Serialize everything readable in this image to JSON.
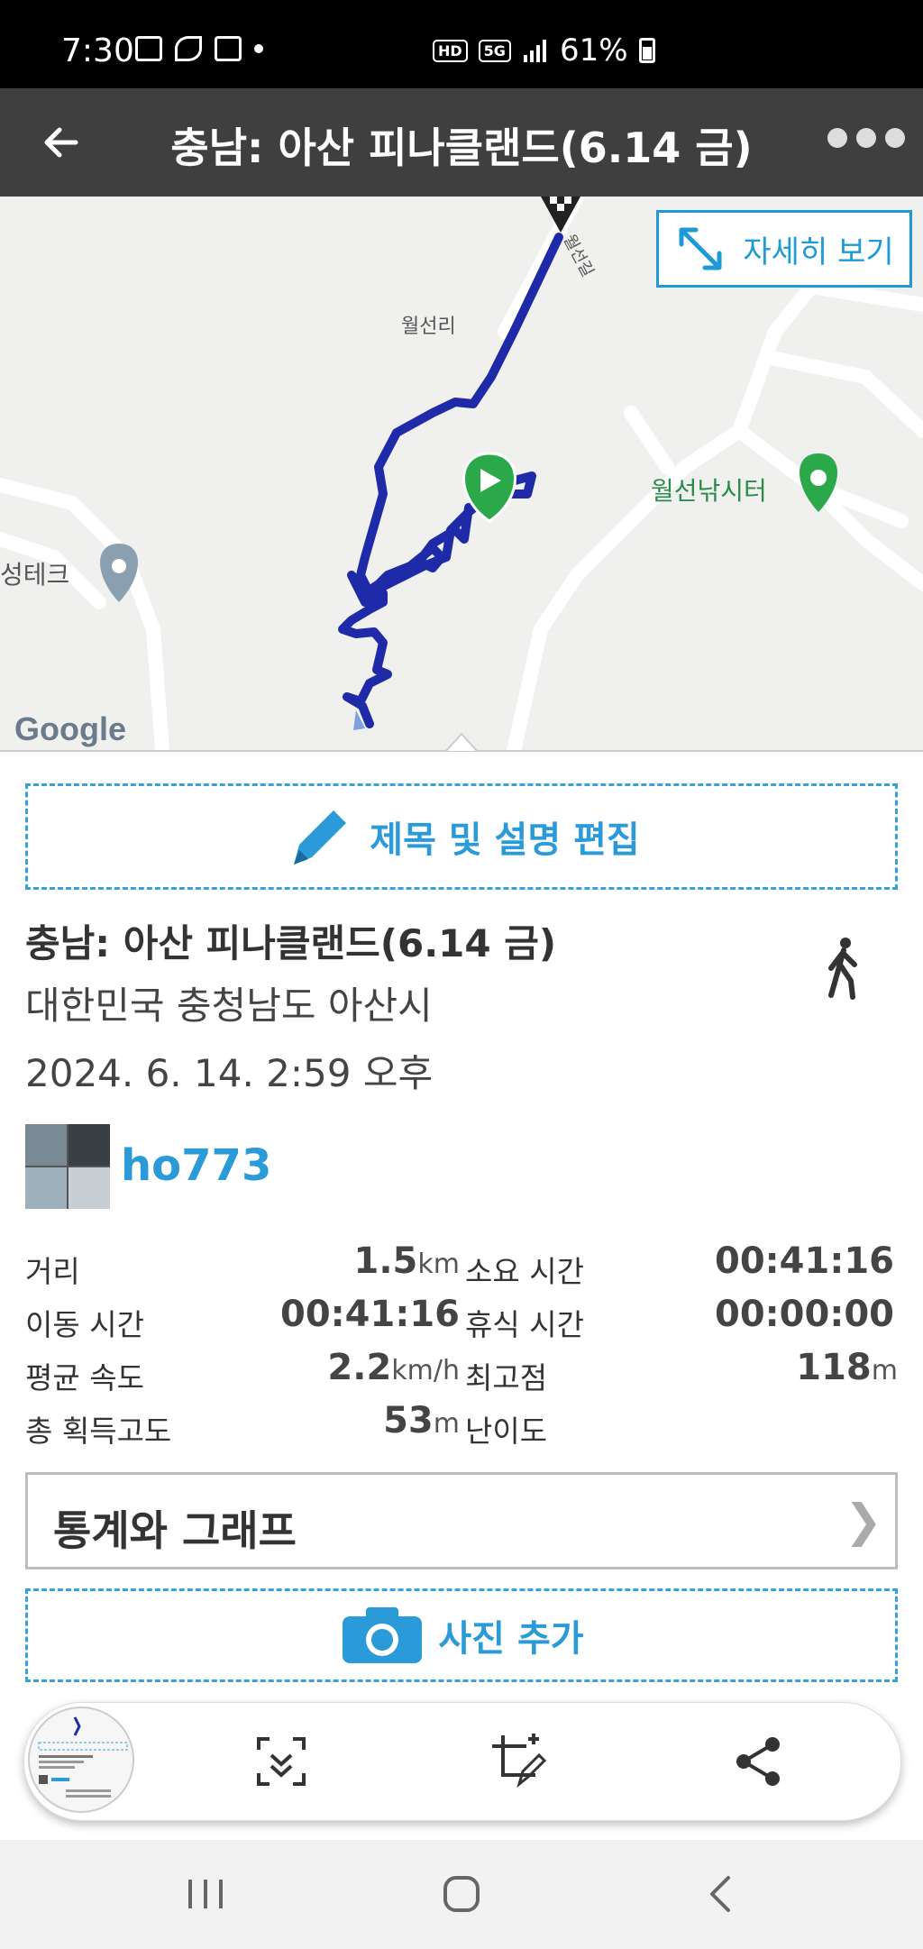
{
  "status_bar": {
    "time": "7:30",
    "hd": "HD",
    "network": "5G",
    "battery": "61%"
  },
  "header": {
    "title": "충남: 아산 피나클랜드(6.14 금)"
  },
  "map": {
    "place_labels": [
      "월선리",
      "월선낚시터",
      "성테크",
      "월선길"
    ],
    "provider": "Google",
    "expand_label": "자세히 보기"
  },
  "edit": {
    "label": "제목 및 설명 편집"
  },
  "trip": {
    "title": "충남: 아산 피나클랜드(6.14 금)",
    "location": "대한민국 충청남도 아산시",
    "datetime": "2024. 6. 14. 2:59 오후",
    "user": "ho773"
  },
  "stats": {
    "distance": {
      "label": "거리",
      "value": "1.5",
      "unit": "km"
    },
    "duration": {
      "label": "소요 시간",
      "value": "00:41:16"
    },
    "moving_time": {
      "label": "이동 시간",
      "value": "00:41:16"
    },
    "rest_time": {
      "label": "휴식 시간",
      "value": "00:00:00"
    },
    "avg_speed": {
      "label": "평균 속도",
      "value": "2.2",
      "unit": "km/h"
    },
    "max_elev": {
      "label": "최고점",
      "value": "118",
      "unit": "m"
    },
    "elev_gain": {
      "label": "총 획득고도",
      "value": "53",
      "unit": "m"
    },
    "difficulty": {
      "label": "난이도"
    }
  },
  "buttons": {
    "graphs": "통계와 그래프",
    "graphs_chevron": "❯",
    "add_photo": "사진 추가"
  },
  "colors": {
    "accent": "#2a9ad8",
    "track": "#1f2aa8",
    "start_pin": "#2aa84a"
  }
}
